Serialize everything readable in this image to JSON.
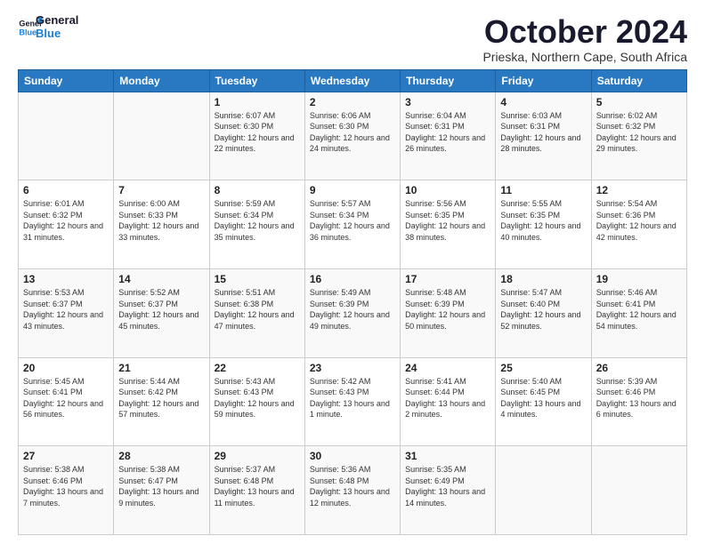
{
  "logo": {
    "line1": "General",
    "line2": "Blue"
  },
  "title": "October 2024",
  "subtitle": "Prieska, Northern Cape, South Africa",
  "weekdays": [
    "Sunday",
    "Monday",
    "Tuesday",
    "Wednesday",
    "Thursday",
    "Friday",
    "Saturday"
  ],
  "weeks": [
    [
      {
        "day": "",
        "detail": ""
      },
      {
        "day": "",
        "detail": ""
      },
      {
        "day": "1",
        "detail": "Sunrise: 6:07 AM\nSunset: 6:30 PM\nDaylight: 12 hours and 22 minutes."
      },
      {
        "day": "2",
        "detail": "Sunrise: 6:06 AM\nSunset: 6:30 PM\nDaylight: 12 hours and 24 minutes."
      },
      {
        "day": "3",
        "detail": "Sunrise: 6:04 AM\nSunset: 6:31 PM\nDaylight: 12 hours and 26 minutes."
      },
      {
        "day": "4",
        "detail": "Sunrise: 6:03 AM\nSunset: 6:31 PM\nDaylight: 12 hours and 28 minutes."
      },
      {
        "day": "5",
        "detail": "Sunrise: 6:02 AM\nSunset: 6:32 PM\nDaylight: 12 hours and 29 minutes."
      }
    ],
    [
      {
        "day": "6",
        "detail": "Sunrise: 6:01 AM\nSunset: 6:32 PM\nDaylight: 12 hours and 31 minutes."
      },
      {
        "day": "7",
        "detail": "Sunrise: 6:00 AM\nSunset: 6:33 PM\nDaylight: 12 hours and 33 minutes."
      },
      {
        "day": "8",
        "detail": "Sunrise: 5:59 AM\nSunset: 6:34 PM\nDaylight: 12 hours and 35 minutes."
      },
      {
        "day": "9",
        "detail": "Sunrise: 5:57 AM\nSunset: 6:34 PM\nDaylight: 12 hours and 36 minutes."
      },
      {
        "day": "10",
        "detail": "Sunrise: 5:56 AM\nSunset: 6:35 PM\nDaylight: 12 hours and 38 minutes."
      },
      {
        "day": "11",
        "detail": "Sunrise: 5:55 AM\nSunset: 6:35 PM\nDaylight: 12 hours and 40 minutes."
      },
      {
        "day": "12",
        "detail": "Sunrise: 5:54 AM\nSunset: 6:36 PM\nDaylight: 12 hours and 42 minutes."
      }
    ],
    [
      {
        "day": "13",
        "detail": "Sunrise: 5:53 AM\nSunset: 6:37 PM\nDaylight: 12 hours and 43 minutes."
      },
      {
        "day": "14",
        "detail": "Sunrise: 5:52 AM\nSunset: 6:37 PM\nDaylight: 12 hours and 45 minutes."
      },
      {
        "day": "15",
        "detail": "Sunrise: 5:51 AM\nSunset: 6:38 PM\nDaylight: 12 hours and 47 minutes."
      },
      {
        "day": "16",
        "detail": "Sunrise: 5:49 AM\nSunset: 6:39 PM\nDaylight: 12 hours and 49 minutes."
      },
      {
        "day": "17",
        "detail": "Sunrise: 5:48 AM\nSunset: 6:39 PM\nDaylight: 12 hours and 50 minutes."
      },
      {
        "day": "18",
        "detail": "Sunrise: 5:47 AM\nSunset: 6:40 PM\nDaylight: 12 hours and 52 minutes."
      },
      {
        "day": "19",
        "detail": "Sunrise: 5:46 AM\nSunset: 6:41 PM\nDaylight: 12 hours and 54 minutes."
      }
    ],
    [
      {
        "day": "20",
        "detail": "Sunrise: 5:45 AM\nSunset: 6:41 PM\nDaylight: 12 hours and 56 minutes."
      },
      {
        "day": "21",
        "detail": "Sunrise: 5:44 AM\nSunset: 6:42 PM\nDaylight: 12 hours and 57 minutes."
      },
      {
        "day": "22",
        "detail": "Sunrise: 5:43 AM\nSunset: 6:43 PM\nDaylight: 12 hours and 59 minutes."
      },
      {
        "day": "23",
        "detail": "Sunrise: 5:42 AM\nSunset: 6:43 PM\nDaylight: 13 hours and 1 minute."
      },
      {
        "day": "24",
        "detail": "Sunrise: 5:41 AM\nSunset: 6:44 PM\nDaylight: 13 hours and 2 minutes."
      },
      {
        "day": "25",
        "detail": "Sunrise: 5:40 AM\nSunset: 6:45 PM\nDaylight: 13 hours and 4 minutes."
      },
      {
        "day": "26",
        "detail": "Sunrise: 5:39 AM\nSunset: 6:46 PM\nDaylight: 13 hours and 6 minutes."
      }
    ],
    [
      {
        "day": "27",
        "detail": "Sunrise: 5:38 AM\nSunset: 6:46 PM\nDaylight: 13 hours and 7 minutes."
      },
      {
        "day": "28",
        "detail": "Sunrise: 5:38 AM\nSunset: 6:47 PM\nDaylight: 13 hours and 9 minutes."
      },
      {
        "day": "29",
        "detail": "Sunrise: 5:37 AM\nSunset: 6:48 PM\nDaylight: 13 hours and 11 minutes."
      },
      {
        "day": "30",
        "detail": "Sunrise: 5:36 AM\nSunset: 6:48 PM\nDaylight: 13 hours and 12 minutes."
      },
      {
        "day": "31",
        "detail": "Sunrise: 5:35 AM\nSunset: 6:49 PM\nDaylight: 13 hours and 14 minutes."
      },
      {
        "day": "",
        "detail": ""
      },
      {
        "day": "",
        "detail": ""
      }
    ]
  ]
}
